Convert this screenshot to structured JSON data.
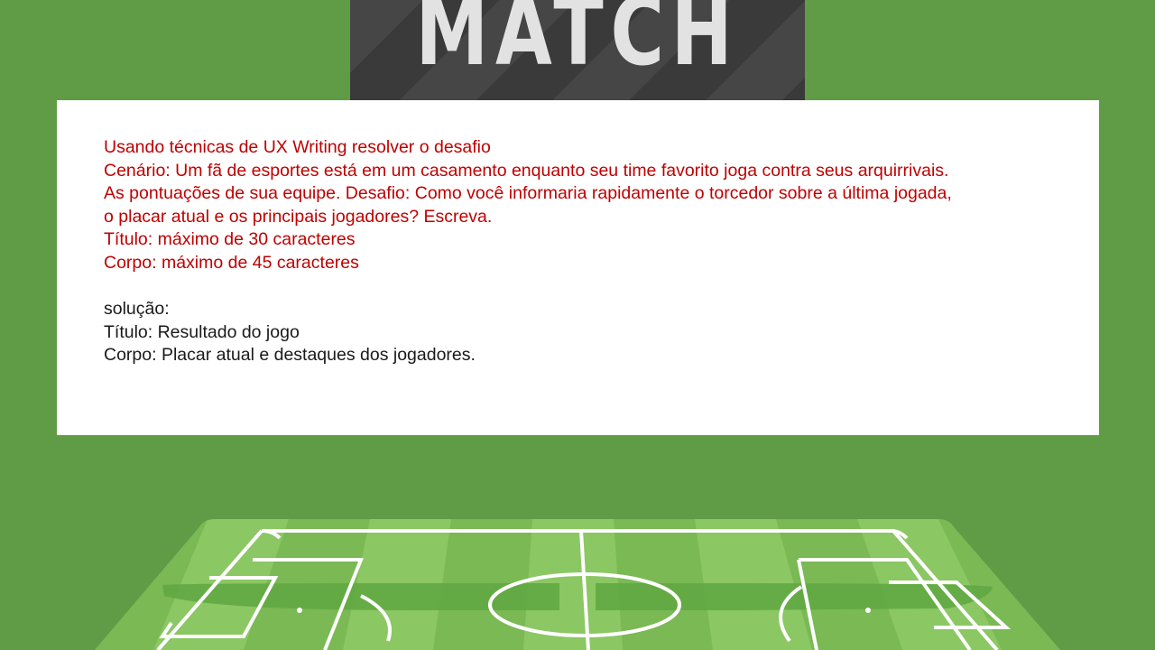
{
  "scoreboard": {
    "title": "MATCH"
  },
  "challenge": {
    "lines": [
      "Usando técnicas de UX Writing resolver o desafio",
      "Cenário: Um fã de esportes está em um casamento enquanto seu time favorito joga contra seus arquirrivais.",
      "As pontuações de sua equipe. Desafio: Como você informaria rapidamente o torcedor sobre a última jogada,",
      "o placar atual e os principais jogadores? Escreva.",
      "Título: máximo de 30 caracteres",
      "Corpo: máximo de 45 caracteres"
    ]
  },
  "solution": {
    "heading": "solução:",
    "title_line": "Título: Resultado do jogo",
    "body_line": "Corpo: Placar atual e destaques dos jogadores."
  },
  "colors": {
    "background": "#5f9c45",
    "field_light": "#8bc763",
    "field_dark": "#7ab954",
    "text_red": "#c00000"
  },
  "icons": [
    "scoreboard-graphic",
    "soccer-field-graphic"
  ]
}
